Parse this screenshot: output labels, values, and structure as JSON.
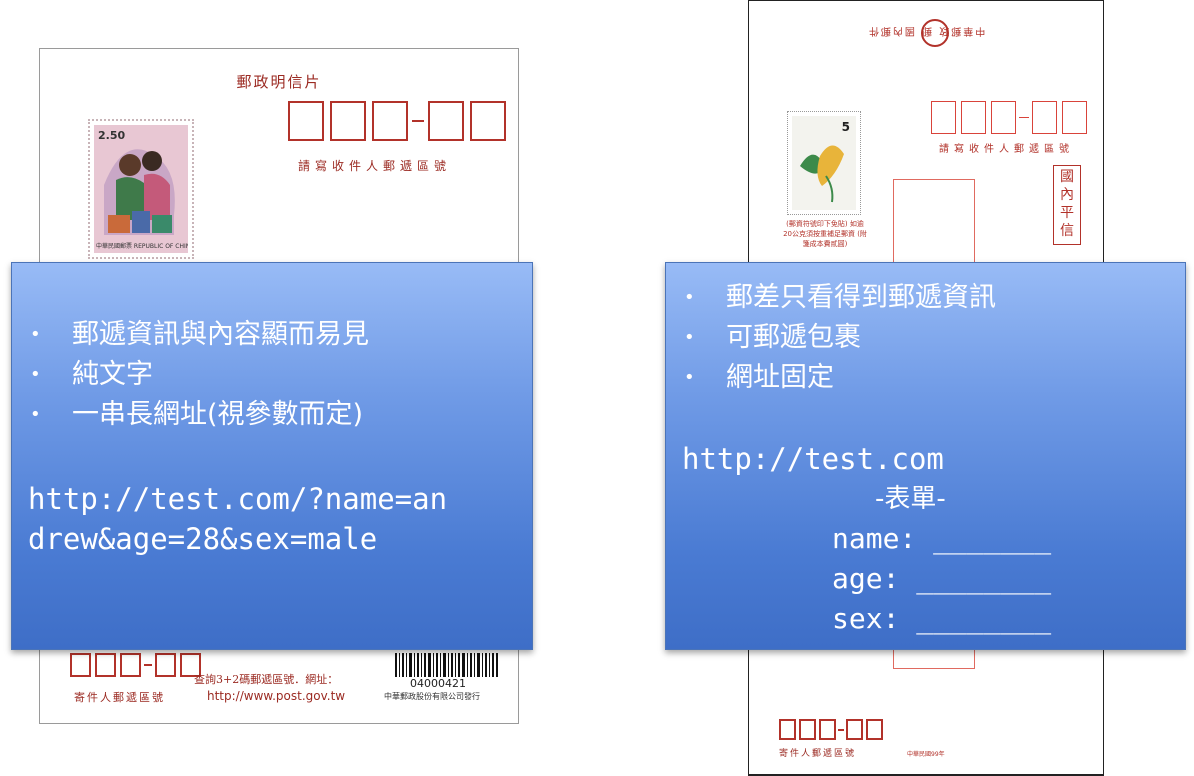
{
  "postcard": {
    "title": "郵政明信片",
    "zip_label": "請寫收件人郵遞區號",
    "stamp_value": "2.50",
    "stamp_caption": "中華民國郵票 REPUBLIC OF CHINA (TAIWAN)",
    "sender_zip_label": "寄件人郵遞區號",
    "query_text": "查詢3+2碼郵遞區號．網址：",
    "url": "http://www.post.gov.tw",
    "barcode_number": "04000421",
    "issuer": "中華郵政股份有限公司發行"
  },
  "envelope": {
    "header": "中華郵政 郵 國內郵件",
    "zip_label": "請寫收件人郵遞區號",
    "stamp_value": "5",
    "stamp_note": "(郵資符號印下免貼) 如逾20公克須按重補足郵資 (附箋成本費貳圓)",
    "domestic_box": "國內平信",
    "sender_zip_label": "寄件人郵遞區號",
    "year": "中華民國99年"
  },
  "left_box": {
    "bullets": [
      "郵遞資訊與內容顯而易見",
      "純文字",
      "一串長網址(視參數而定)"
    ],
    "url_line1": "http://test.com/?name=an",
    "url_line2": "drew&age=28&sex=male"
  },
  "right_box": {
    "bullets": [
      "郵差只看得到郵遞資訊",
      "可郵遞包裹",
      "網址固定"
    ],
    "url": "http://test.com",
    "form_title": "-表單-",
    "form_name": "name: _______",
    "form_age": "age: ________",
    "form_sex": "sex: ________"
  },
  "colors": {
    "postal_red": "#b2322a",
    "callout_blue": "#4a7bd3"
  }
}
